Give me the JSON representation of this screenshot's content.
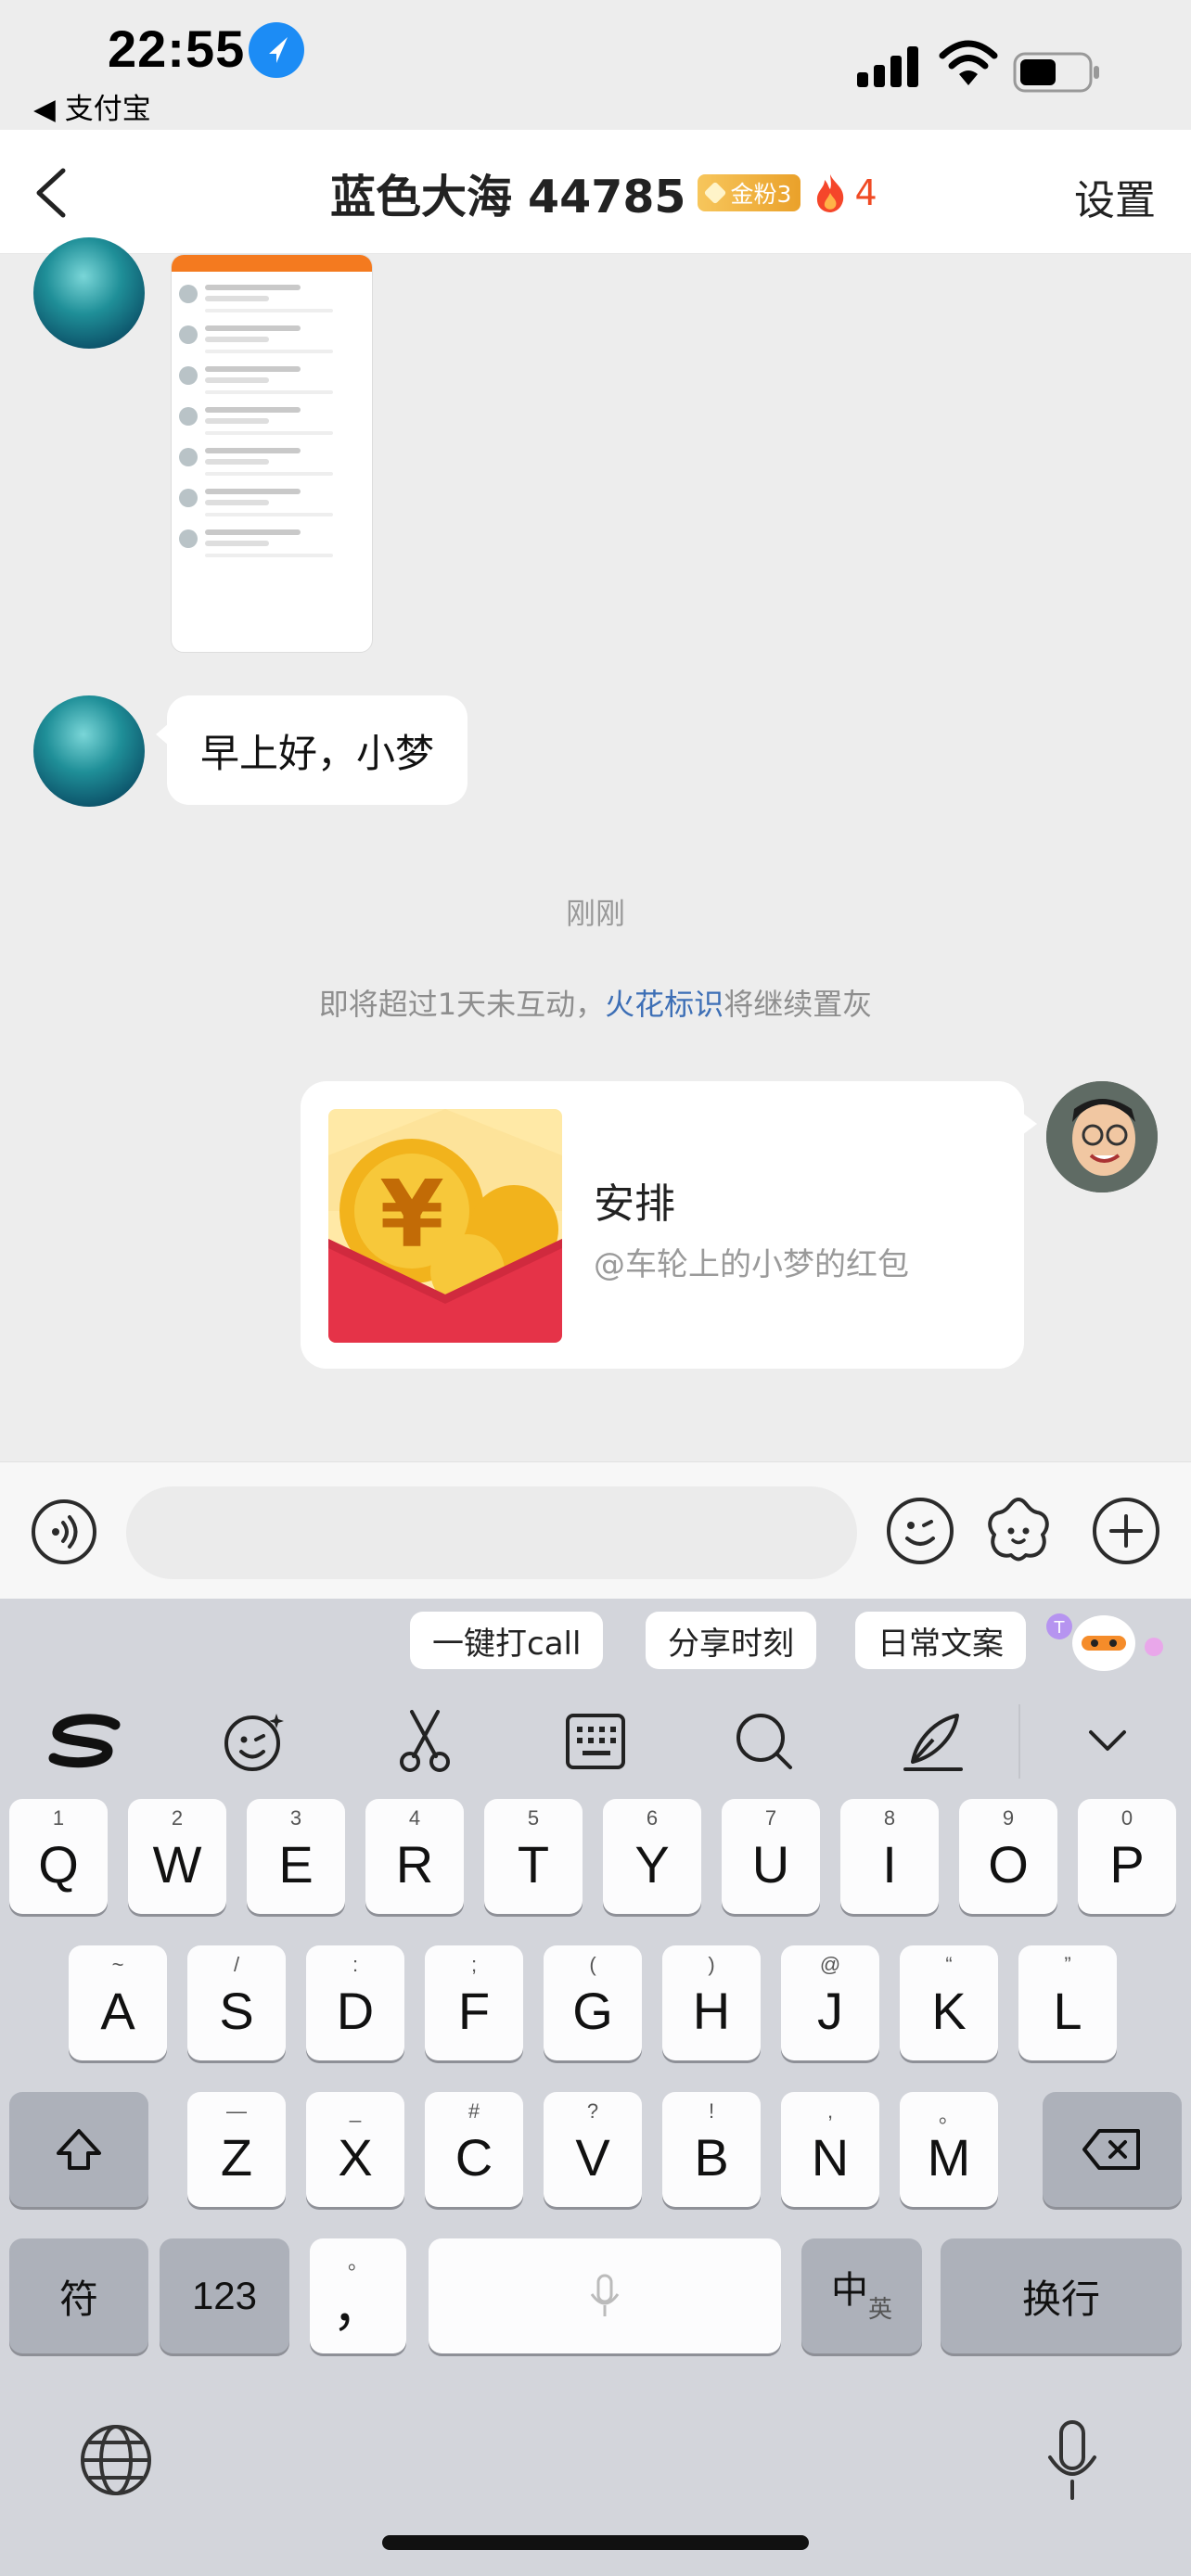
{
  "status_bar": {
    "time": "22:55",
    "back_app": "◀ 支付宝"
  },
  "header": {
    "title": "蓝色大海 44785",
    "fan_badge": "金粉3",
    "fire_count": "4",
    "settings": "设置"
  },
  "messages": {
    "greeting": "早上好，小梦",
    "time_label": "刚刚",
    "notice_prefix": "即将超过1天未互动，",
    "notice_link": "火花标识",
    "notice_suffix": "将继续置灰",
    "red_packet": {
      "title": "安排",
      "subtitle": "@车轮上的小梦的红包"
    }
  },
  "input": {
    "value": "",
    "placeholder": ""
  },
  "keyboard": {
    "suggestions": [
      "一键打call",
      "分享时刻",
      "日常文案"
    ],
    "tools": [
      "sogou-logo-icon",
      "emoji-icon",
      "scissors-icon",
      "keyboard-icon",
      "search-icon",
      "pen-icon",
      "chevron-down-icon"
    ],
    "row1": [
      {
        "k": "Q",
        "h": "1"
      },
      {
        "k": "W",
        "h": "2"
      },
      {
        "k": "E",
        "h": "3"
      },
      {
        "k": "R",
        "h": "4"
      },
      {
        "k": "T",
        "h": "5"
      },
      {
        "k": "Y",
        "h": "6"
      },
      {
        "k": "U",
        "h": "7"
      },
      {
        "k": "I",
        "h": "8"
      },
      {
        "k": "O",
        "h": "9"
      },
      {
        "k": "P",
        "h": "0"
      }
    ],
    "row2": [
      {
        "k": "A",
        "h": "~"
      },
      {
        "k": "S",
        "h": "/"
      },
      {
        "k": "D",
        "h": ":"
      },
      {
        "k": "F",
        "h": ";"
      },
      {
        "k": "G",
        "h": "("
      },
      {
        "k": "H",
        "h": ")"
      },
      {
        "k": "J",
        "h": "@"
      },
      {
        "k": "K",
        "h": "“"
      },
      {
        "k": "L",
        "h": "”"
      }
    ],
    "row3": [
      {
        "k": "Z",
        "h": "—"
      },
      {
        "k": "X",
        "h": "_"
      },
      {
        "k": "C",
        "h": "#"
      },
      {
        "k": "V",
        "h": "?"
      },
      {
        "k": "B",
        "h": "!"
      },
      {
        "k": "N",
        "h": ","
      },
      {
        "k": "M",
        "h": "。"
      }
    ],
    "symbols_key": "符",
    "num_key": "123",
    "comma_key": "，",
    "comma_hint": "。",
    "lang_key": "中",
    "lang_sub": "英",
    "enter_key": "换行"
  }
}
